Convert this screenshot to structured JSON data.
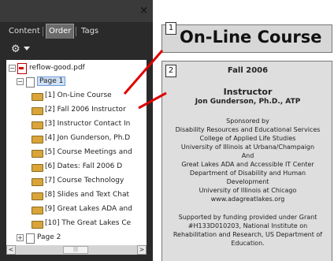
{
  "panel": {
    "close_glyph": "×",
    "tabs": [
      {
        "label": "Content",
        "active": false
      },
      {
        "label": "Order",
        "active": true
      },
      {
        "label": "Tags",
        "active": false
      }
    ],
    "options_icon": "gear-icon",
    "tree": {
      "root": "reflow-good.pdf",
      "page1": "Page 1",
      "items": [
        "[1] On-Line Course",
        "[2] Fall 2006  Instructor",
        "[3] Instructor Contact In",
        "[4] Jon Gunderson, Ph.D",
        "[5] Course Meetings and",
        "[6] Dates: Fall 2006   D",
        "[7] Course Technology",
        "[8] Slides and Text Chat",
        "[9] Great Lakes ADA and",
        "[10] The Great Lakes Ce"
      ],
      "page2": "Page 2"
    },
    "scroll": {
      "left": "<",
      "right": ">",
      "thumb": "|||"
    }
  },
  "content": {
    "heading_badge": "1",
    "heading": "On-Line Course",
    "body_badge": "2",
    "lines": [
      "Fall 2006",
      "Instructor",
      "Jon Gunderson, Ph.D., ATP",
      "Sponsored by",
      "Disability Resources and Educational Services",
      "College of Applied Life Studies",
      "University of Illinois at Urbana/Champaign",
      "And",
      "Great Lakes ADA and Accessible IT Center",
      "Department of Disability and Human",
      "Development",
      "University of Illinois at Chicago",
      "www.adagreatlakes.org",
      "Supported by funding provided under Grant",
      "#H133D010203, National Institute on",
      "Rehabilitation and Research, US Department of",
      "Education."
    ]
  },
  "colors": {
    "panel_bg": "#2a2a2a",
    "tree_bg": "#ffffff",
    "box_bg": "#dedede",
    "connector": "#e00000",
    "selection": "#cfe1f7"
  }
}
